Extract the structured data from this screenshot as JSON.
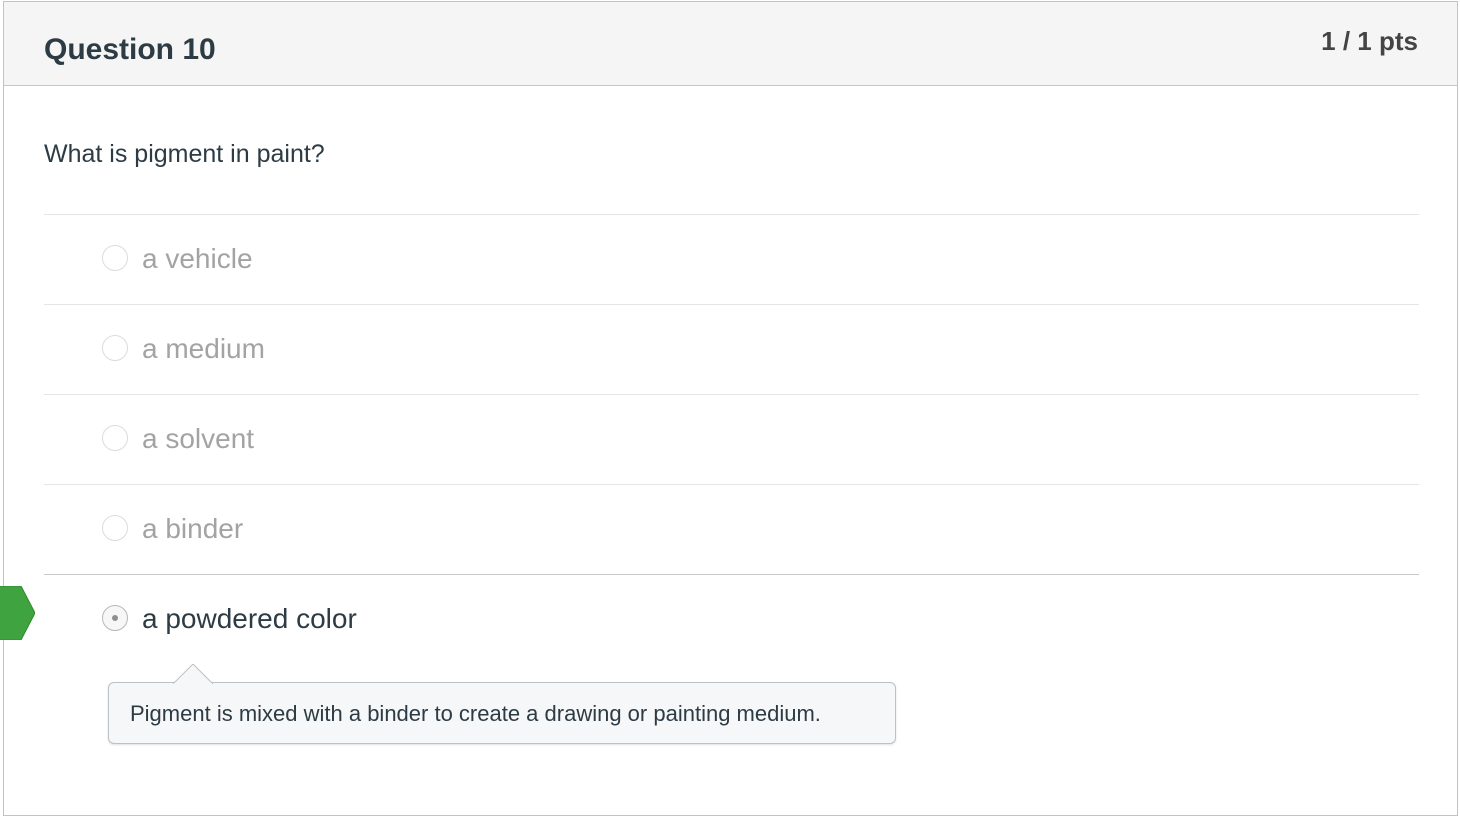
{
  "question": {
    "title": "Question 10",
    "points": "1 / 1 pts",
    "text": "What is pigment in paint?"
  },
  "answers": [
    {
      "label": "a vehicle",
      "selected": false
    },
    {
      "label": "a medium",
      "selected": false
    },
    {
      "label": "a solvent",
      "selected": false
    },
    {
      "label": "a binder",
      "selected": false
    },
    {
      "label": "a powdered color",
      "selected": true,
      "correct": true
    }
  ],
  "feedback": {
    "text": "Pigment is mixed with a binder to create a drawing or painting medium."
  },
  "colors": {
    "correct_flag": "#3fa33f",
    "header_bg": "#f5f5f5",
    "text": "#2d3b45",
    "muted_text": "#a3a3a3"
  },
  "icons": {
    "correct_indicator": "correct-answer-flag-icon"
  }
}
